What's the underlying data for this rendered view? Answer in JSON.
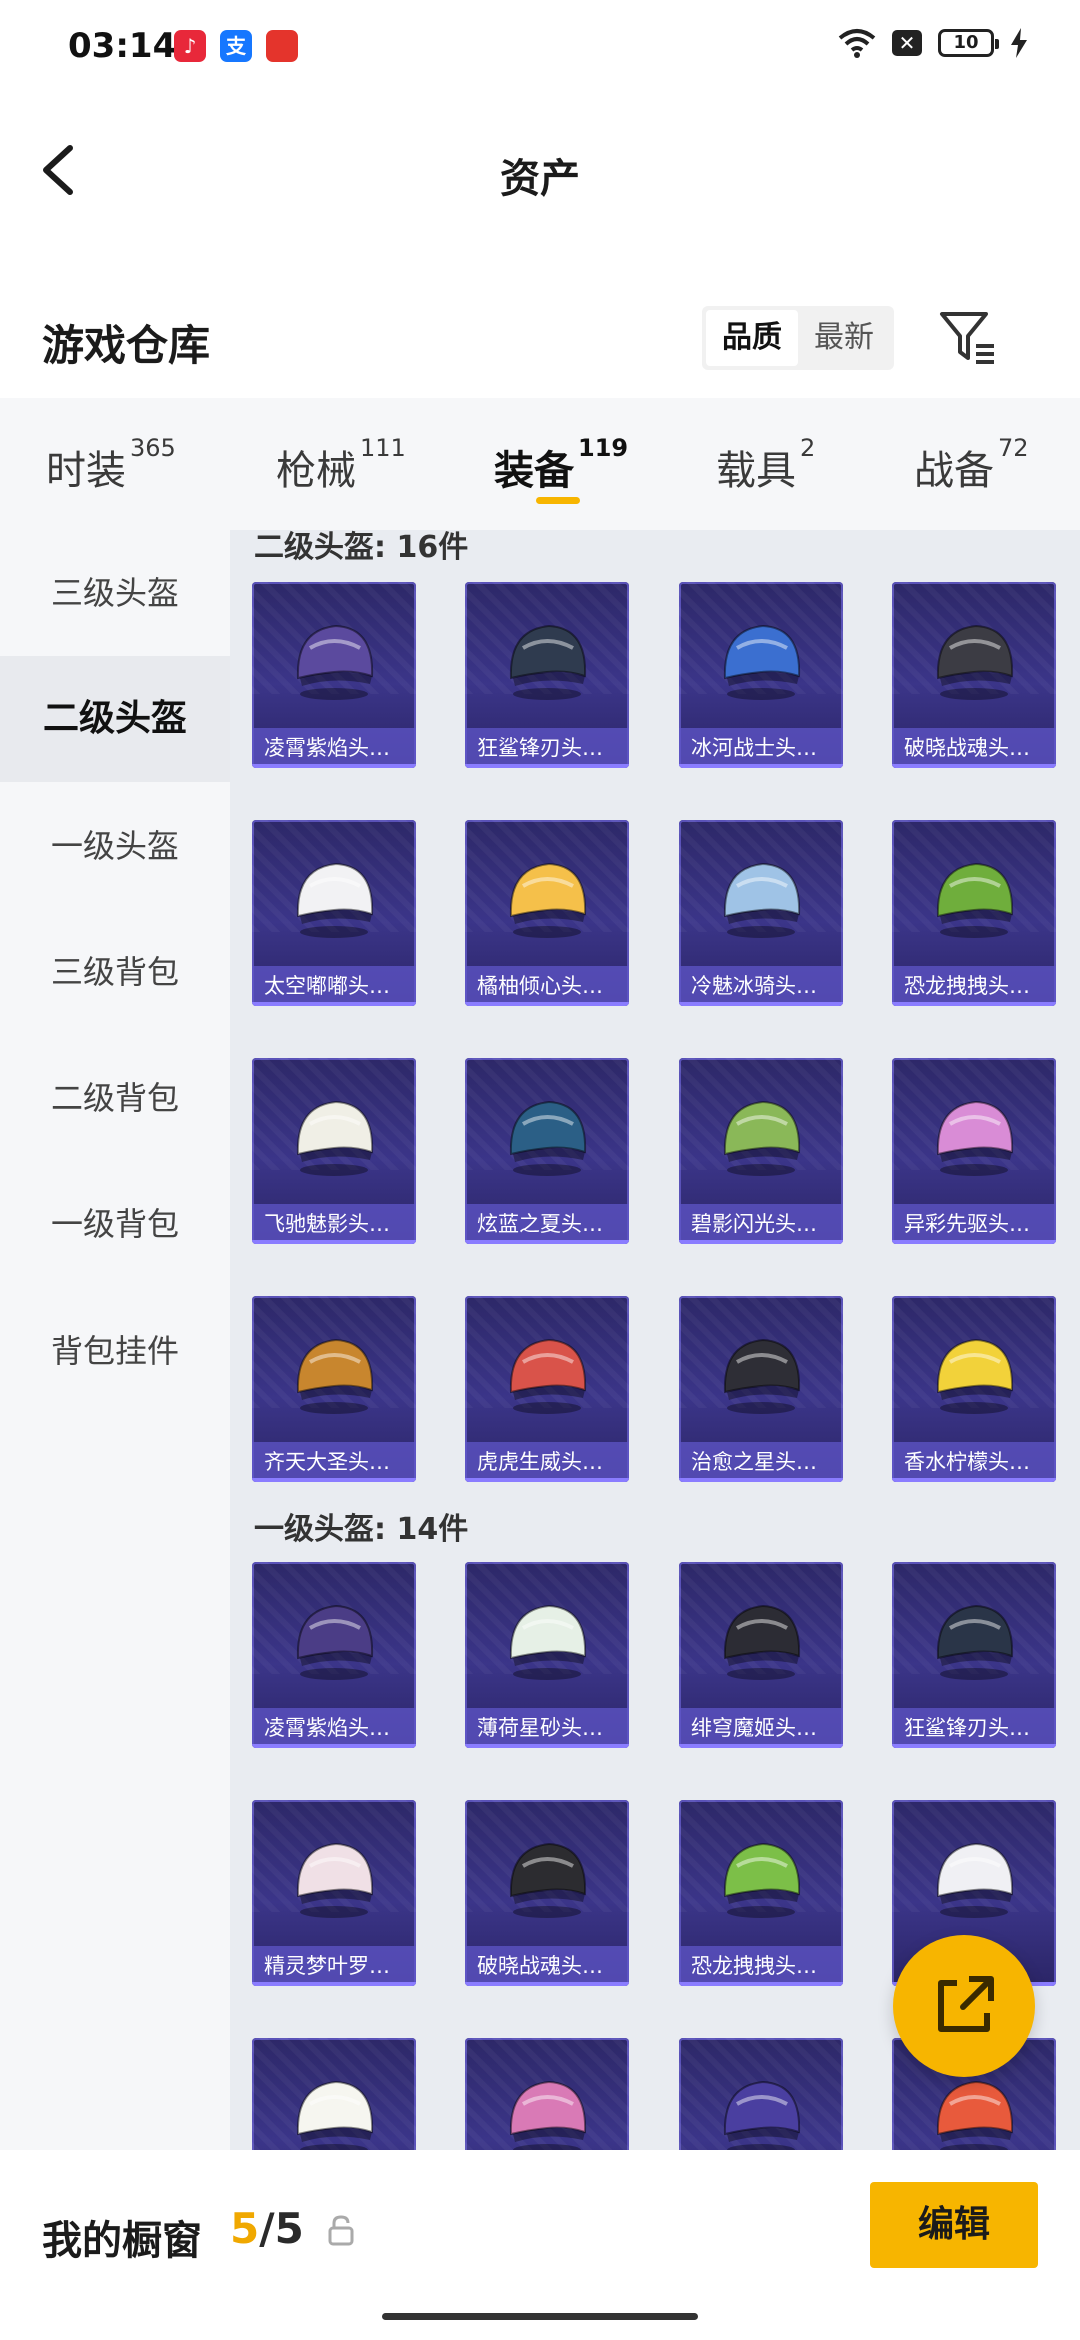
{
  "status": {
    "time": "03:14",
    "battery": "10",
    "app_icons": [
      {
        "name": "music-app-icon",
        "glyph": "♪",
        "color": "#e8283a"
      },
      {
        "name": "alipay-app-icon",
        "glyph": "支",
        "color": "#1677ff"
      },
      {
        "name": "shop-app-icon",
        "glyph": "",
        "color": "#e4342c"
      }
    ]
  },
  "header": {
    "title": "资产"
  },
  "section": {
    "title": "游戏仓库"
  },
  "sort": {
    "options": [
      "品质",
      "最新"
    ],
    "active": 0
  },
  "tabs": [
    {
      "label": "时装",
      "count": "365"
    },
    {
      "label": "枪械",
      "count": "111"
    },
    {
      "label": "装备",
      "count": "119",
      "active": true
    },
    {
      "label": "载具",
      "count": "2"
    },
    {
      "label": "战备",
      "count": "72"
    }
  ],
  "sidebar": {
    "items": [
      "三级头盔",
      "二级头盔",
      "一级头盔",
      "三级背包",
      "二级背包",
      "一级背包",
      "背包挂件"
    ],
    "active_index": 1
  },
  "groups": [
    {
      "title": "二级头盔: 16件",
      "items": [
        {
          "name": "凌霄紫焰头…",
          "color": "#5b4a9e"
        },
        {
          "name": "狂鲨锋刃头…",
          "color": "#2f3b4f"
        },
        {
          "name": "冰河战士头…",
          "color": "#3b6fd0"
        },
        {
          "name": "破晓战魂头…",
          "color": "#3c3c44"
        },
        {
          "name": "太空嘟嘟头…",
          "color": "#f2f2f4"
        },
        {
          "name": "橘柚倾心头…",
          "color": "#f5c04a"
        },
        {
          "name": "冷魅冰骑头…",
          "color": "#9fc3e6"
        },
        {
          "name": "恐龙拽拽头…",
          "color": "#6fae3c"
        },
        {
          "name": "飞驰魅影头…",
          "color": "#f0efe6"
        },
        {
          "name": "炫蓝之夏头…",
          "color": "#2b5f86"
        },
        {
          "name": "碧影闪光头…",
          "color": "#8ab858"
        },
        {
          "name": "异彩先驱头…",
          "color": "#d98cd6"
        },
        {
          "name": "齐天大圣头…",
          "color": "#c8862e"
        },
        {
          "name": "虎虎生威头…",
          "color": "#d9534a"
        },
        {
          "name": "治愈之星头…",
          "color": "#2e2e36"
        },
        {
          "name": "香水柠檬头…",
          "color": "#f2d23a"
        }
      ]
    },
    {
      "title": "一级头盔: 14件",
      "items": [
        {
          "name": "凌霄紫焰头…",
          "color": "#4b3d86"
        },
        {
          "name": "薄荷星砂头…",
          "color": "#e6f0e6"
        },
        {
          "name": "绯穹魔姬头…",
          "color": "#2c2c34"
        },
        {
          "name": "狂鲨锋刃头…",
          "color": "#2a3548"
        },
        {
          "name": "精灵梦叶罗…",
          "color": "#f0e0e6"
        },
        {
          "name": "破晓战魂头…",
          "color": "#2c2c30"
        },
        {
          "name": "恐龙拽拽头…",
          "color": "#7cbf48"
        },
        {
          "name": "",
          "color": "#f0f0f4"
        },
        {
          "name": "",
          "color": "#f6f6f0"
        },
        {
          "name": "",
          "color": "#d97ab6"
        },
        {
          "name": "",
          "color": "#4a3fa0"
        },
        {
          "name": "",
          "color": "#e85a3c"
        }
      ]
    }
  ],
  "bottom": {
    "label": "我的橱窗",
    "current": "5",
    "total": "/5",
    "edit_label": "编辑"
  },
  "colors": {
    "accent": "#f7b500",
    "card_bg": "#3b3589"
  }
}
